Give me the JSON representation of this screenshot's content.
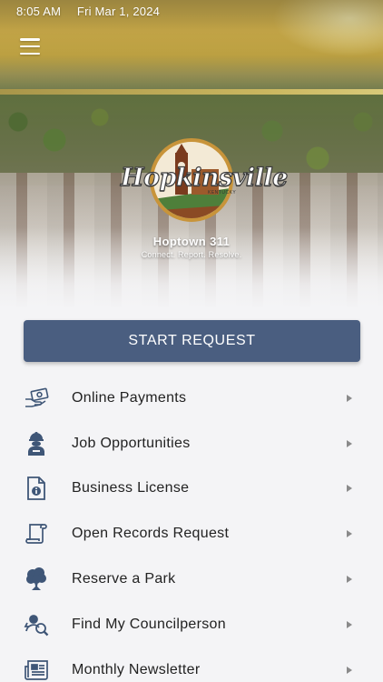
{
  "status_bar": {
    "time": "8:05 AM",
    "date": "Fri Mar 1, 2024"
  },
  "logo": {
    "wordmark": "Hopkinsville",
    "state": "KENTUCKY"
  },
  "brand": {
    "title": "Hoptown 311",
    "tagline": "Connect. Report. Resolve."
  },
  "primary_action": {
    "label": "START REQUEST"
  },
  "colors": {
    "button": "#4a5e80",
    "icon": "#3f5677",
    "text": "#222222",
    "background": "#f4f4f6"
  },
  "menu": [
    {
      "label": "Online Payments",
      "icon": "money-hand-icon"
    },
    {
      "label": "Job Opportunities",
      "icon": "worker-icon"
    },
    {
      "label": "Business License",
      "icon": "document-info-icon"
    },
    {
      "label": "Open Records Request",
      "icon": "scroll-icon"
    },
    {
      "label": "Reserve a Park",
      "icon": "tree-icon"
    },
    {
      "label": "Find My Councilperson",
      "icon": "person-search-icon"
    },
    {
      "label": "Monthly Newsletter",
      "icon": "newspaper-icon"
    }
  ]
}
